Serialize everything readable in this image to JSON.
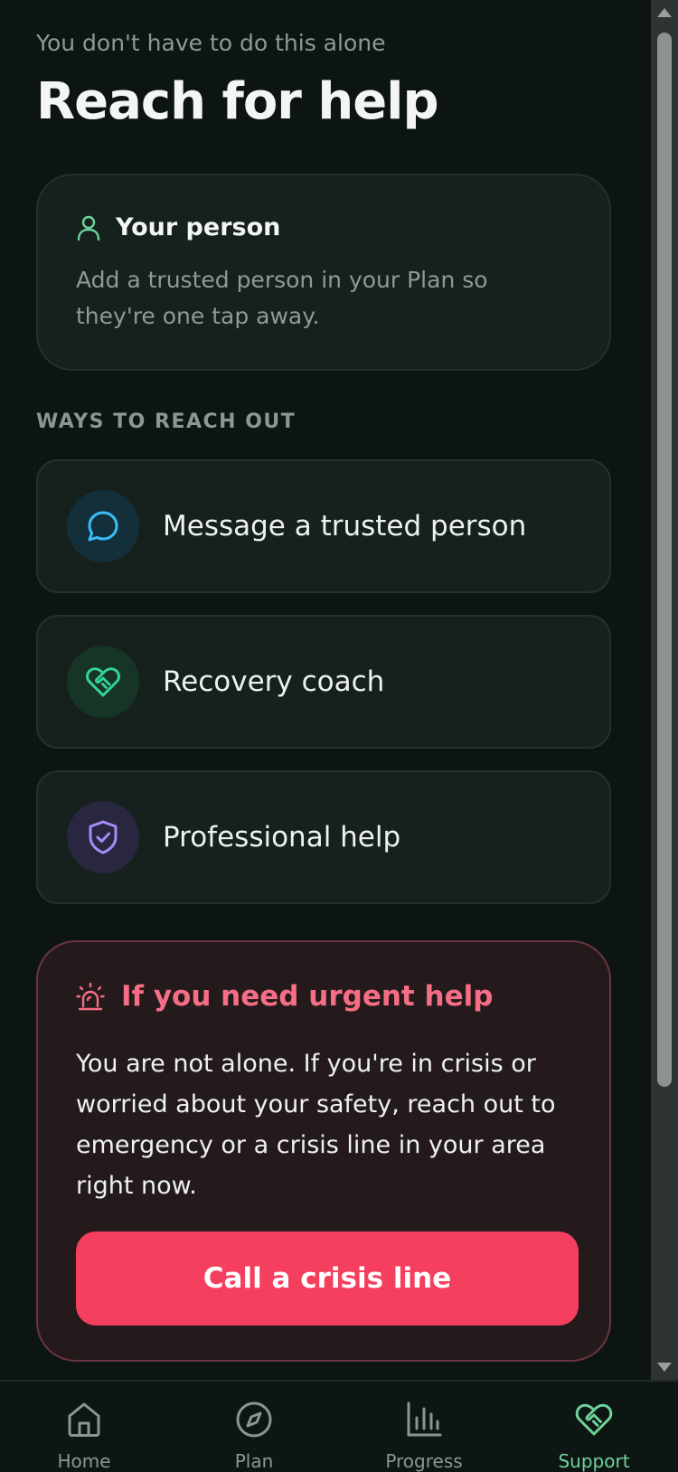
{
  "header": {
    "subtitle": "You don't have to do this alone",
    "title": "Reach for help"
  },
  "person_card": {
    "icon": "user-icon",
    "title": "Your person",
    "body": "Add a trusted person in your Plan so they're one tap away."
  },
  "section_label": "WAYS TO REACH OUT",
  "options": [
    {
      "label": "Message a trusted person",
      "icon": "message-circle-icon",
      "color": "#38bdf8"
    },
    {
      "label": "Recovery coach",
      "icon": "heart-handshake-icon",
      "color": "#34d399"
    },
    {
      "label": "Professional help",
      "icon": "shield-check-icon",
      "color": "#a78bfa"
    }
  ],
  "urgent": {
    "icon": "siren-icon",
    "title": "If you need urgent help",
    "body": "You are not alone. If you're in crisis or worried about your safety, reach out to emergency or a crisis line in your area right now.",
    "button": "Call a crisis line",
    "accent": "#f43f5e"
  },
  "tabs": [
    {
      "label": "Home",
      "icon": "home-icon",
      "active": false
    },
    {
      "label": "Plan",
      "icon": "compass-icon",
      "active": false
    },
    {
      "label": "Progress",
      "icon": "bar-chart-icon",
      "active": false
    },
    {
      "label": "Support",
      "icon": "heart-handshake-icon",
      "active": true
    }
  ],
  "colors": {
    "background": "#0d1512",
    "active_tab": "#6ed39a"
  }
}
